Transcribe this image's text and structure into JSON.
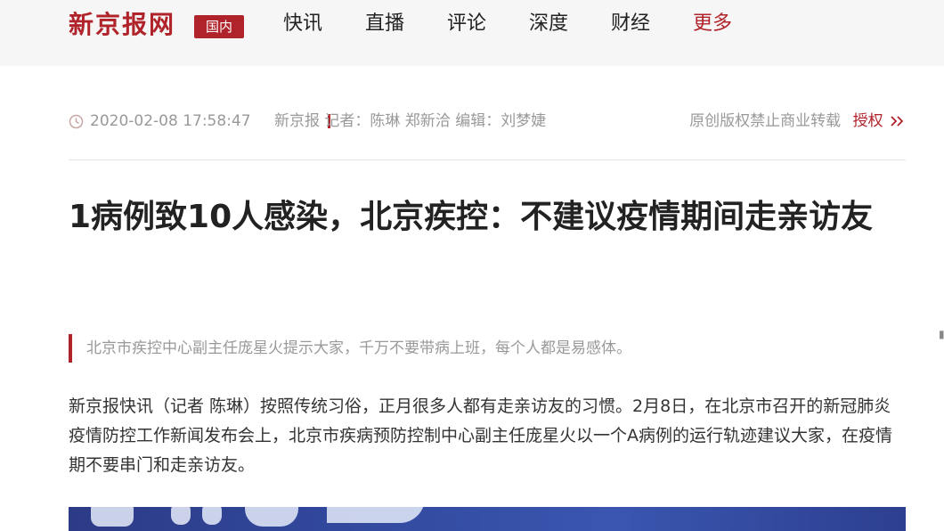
{
  "header": {
    "logo": "新京报网",
    "section_badge": "国内",
    "nav": [
      {
        "label": "快讯"
      },
      {
        "label": "直播"
      },
      {
        "label": "评论"
      },
      {
        "label": "深度"
      },
      {
        "label": "财经"
      },
      {
        "label": "更多"
      }
    ]
  },
  "article": {
    "datetime": "2020-02-08 17:58:47",
    "source_line": "新京报 记者：陈琳 郑新洽 编辑：刘梦婕",
    "copyright_notice": "原创版权禁止商业转载",
    "authorize_label": "授权",
    "title": "1病例致10人感染，北京疾控：不建议疫情期间走亲访友",
    "summary": "北京市疾控中心副主任庞星火提示大家，千万不要带病上班，每个人都是易感体。",
    "body": "新京报快讯（记者 陈琳）按照传统习俗，正月很多人都有走亲访友的习惯。2月8日，在北京市召开的新冠肺炎疫情防控工作新闻发布会上，北京市疾病预防控制中心副主任庞星火以一个A病例的运行轨迹建议大家，在疫情期不要串门和走亲访友。"
  },
  "colors": {
    "brand": "#b0232a",
    "muted_text": "#999999",
    "body_text": "#333333",
    "title_text": "#222222"
  }
}
